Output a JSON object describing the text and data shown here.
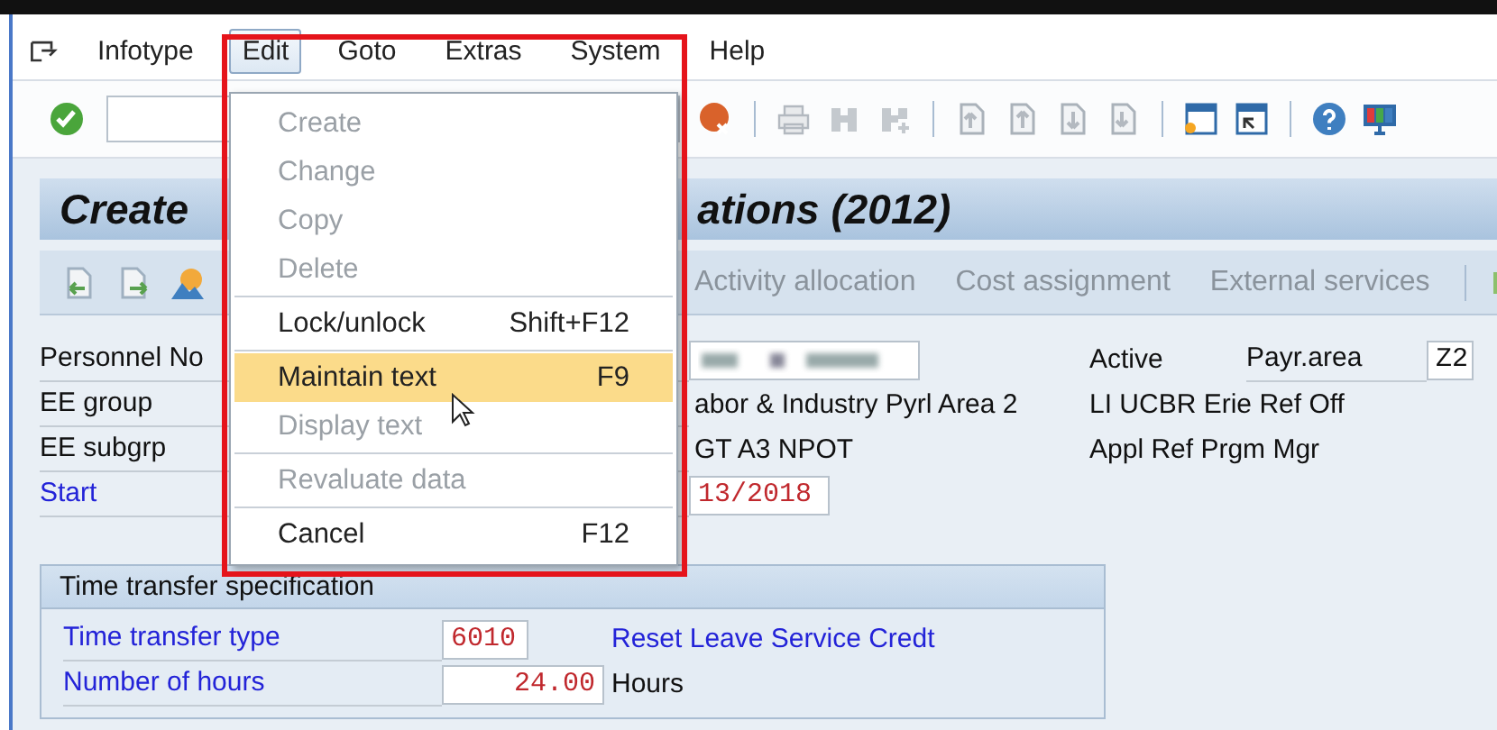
{
  "menu_bar": {
    "items": [
      {
        "label": "Infotype",
        "selected": false
      },
      {
        "label": "Edit",
        "selected": true
      },
      {
        "label": "Goto",
        "selected": false
      },
      {
        "label": "Extras",
        "selected": false
      },
      {
        "label": "System",
        "selected": false
      },
      {
        "label": "Help",
        "selected": false
      }
    ]
  },
  "edit_menu": {
    "groups": [
      {
        "items": [
          {
            "label": "Create",
            "disabled": true,
            "selected": false
          },
          {
            "label": "Change",
            "disabled": true,
            "selected": false
          },
          {
            "label": "Copy",
            "disabled": true,
            "selected": false
          },
          {
            "label": "Delete",
            "disabled": true,
            "selected": false
          }
        ]
      },
      {
        "items": [
          {
            "label": "Lock/unlock",
            "shortcut": "Shift+F12",
            "disabled": false,
            "selected": false
          }
        ]
      },
      {
        "items": [
          {
            "label": "Maintain text",
            "shortcut": "F9",
            "disabled": false,
            "selected": true
          },
          {
            "label": "Display text",
            "disabled": true,
            "selected": false
          }
        ]
      },
      {
        "items": [
          {
            "label": "Revaluate data",
            "disabled": true,
            "selected": false
          }
        ]
      },
      {
        "items": [
          {
            "label": "Cancel",
            "shortcut": "F12",
            "disabled": false,
            "selected": false
          }
        ]
      }
    ]
  },
  "title": {
    "left": "Create",
    "right": "ations (2012)"
  },
  "app_toolbar": {
    "buttons": [
      {
        "label": "Activity allocation",
        "disabled": true
      },
      {
        "label": "Cost assignment",
        "disabled": true
      },
      {
        "label": "External services",
        "disabled": true
      }
    ]
  },
  "header_fields": [
    {
      "label": {
        "text": "Personnel No",
        "kind": "display"
      },
      "value": {
        "kind": "blurred"
      },
      "status": "Active",
      "extra_label": "Payr.area",
      "extra_value": "Z2"
    },
    {
      "label": {
        "text": "EE group",
        "kind": "display"
      },
      "value": {
        "kind": "text",
        "text": "abor & Industry Pyrl Area 2"
      },
      "note": "LI UCBR Erie Ref Off"
    },
    {
      "label": {
        "text": "EE subgrp",
        "kind": "display"
      },
      "value": {
        "kind": "text",
        "text": "GT A3 NPOT"
      },
      "note": "Appl Ref Prgm Mgr"
    },
    {
      "label": {
        "text": "Start",
        "kind": "input"
      },
      "value": {
        "kind": "field",
        "text": "13/2018"
      }
    }
  ],
  "time_transfer": {
    "title": "Time transfer specification",
    "rows": [
      {
        "label": "Time transfer type",
        "field": {
          "kind": "code",
          "value": "6010"
        },
        "description": "Reset Leave Service Credt"
      },
      {
        "label": "Number of hours",
        "field": {
          "kind": "amount",
          "value": "24.00"
        },
        "unit": "Hours"
      }
    ]
  }
}
